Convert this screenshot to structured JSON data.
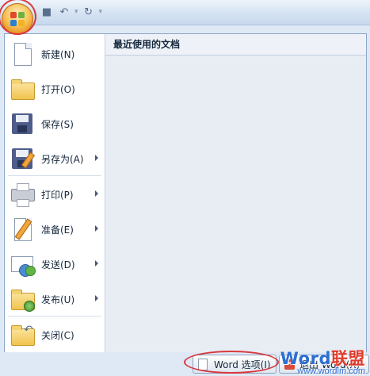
{
  "app": {
    "quick_access": {
      "save_icon": "save-icon",
      "undo_icon": "undo-icon",
      "redo_icon": "redo-icon",
      "customize_icon": "customize-arrow-icon"
    }
  },
  "menu": {
    "items": [
      {
        "label": "新建(N)",
        "icon": "new-document-icon",
        "submenu": false
      },
      {
        "label": "打开(O)",
        "icon": "open-folder-icon",
        "submenu": false
      },
      {
        "label": "保存(S)",
        "icon": "save-disk-icon",
        "submenu": false
      },
      {
        "label": "另存为(A)",
        "icon": "save-as-icon",
        "submenu": true
      },
      {
        "label": "打印(P)",
        "icon": "printer-icon",
        "submenu": true
      },
      {
        "label": "准备(E)",
        "icon": "prepare-pencil-icon",
        "submenu": true
      },
      {
        "label": "发送(D)",
        "icon": "send-mail-icon",
        "submenu": true
      },
      {
        "label": "发布(U)",
        "icon": "publish-folder-icon",
        "submenu": true
      },
      {
        "label": "关闭(C)",
        "icon": "close-folder-icon",
        "submenu": false
      }
    ],
    "recent_documents_header": "最近使用的文档"
  },
  "bottom": {
    "options_label": "Word 选项(I)",
    "exit_label": "退出 Word(X)"
  },
  "watermark": {
    "brand_word": "Word",
    "brand_cn": "联盟",
    "url": "www.wordlm.com"
  },
  "colors": {
    "highlight_ring": "#d9383c",
    "accent_blue": "#2d6fd2"
  }
}
